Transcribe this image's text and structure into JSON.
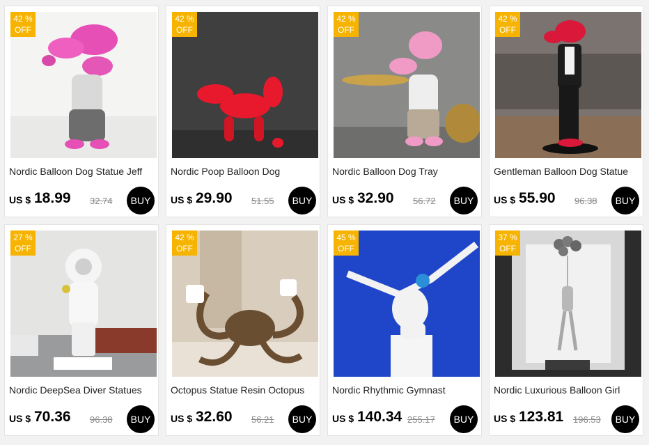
{
  "currency": "US $",
  "buy_label": "BUY",
  "badge_color": "#f6b300",
  "products": [
    {
      "discount": "42 %",
      "off": "OFF",
      "title": "Nordic Balloon Dog Statue Jeff",
      "price": "18.99",
      "old_price": "32.74",
      "image": "pink balloon-dog figure"
    },
    {
      "discount": "42 %",
      "off": "OFF",
      "title": "Nordic Poop Balloon Dog",
      "price": "29.90",
      "old_price": "51.55",
      "image": "red balloon dog on dark background"
    },
    {
      "discount": "42 %",
      "off": "OFF",
      "title": "Nordic Balloon Dog Tray",
      "price": "32.90",
      "old_price": "56.72",
      "image": "balloon dog holding gold tray"
    },
    {
      "discount": "42 %",
      "off": "OFF",
      "title": "Gentleman Balloon Dog Statue",
      "price": "55.90",
      "old_price": "96.38",
      "image": "red balloon dog gentleman in suit"
    },
    {
      "discount": "27 %",
      "off": "OFF",
      "title": "Nordic DeepSea Diver Statues",
      "price": "70.36",
      "old_price": "96.38",
      "image": "white deep sea diver statue"
    },
    {
      "discount": "42 %",
      "off": "OFF",
      "title": "Octopus Statue Resin Octopus",
      "price": "32.60",
      "old_price": "56.21",
      "image": "bronze octopus cup holder"
    },
    {
      "discount": "45 %",
      "off": "OFF",
      "title": "Nordic Rhythmic Gymnast",
      "price": "140.34",
      "old_price": "255.17",
      "image": "white gymnast figure on blue"
    },
    {
      "discount": "37 %",
      "off": "OFF",
      "title": "Nordic Luxurious Balloon Girl",
      "price": "123.81",
      "old_price": "196.53",
      "image": "balloon girl in lit niche"
    }
  ]
}
